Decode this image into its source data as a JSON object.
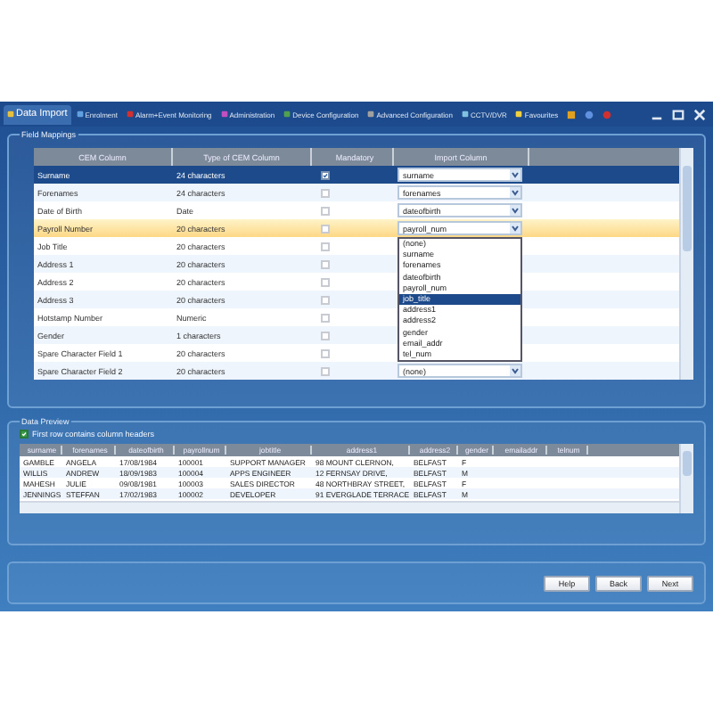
{
  "window": {
    "tabs": [
      {
        "label": "Data Import",
        "selected": true
      },
      {
        "label": "Enrolment",
        "selected": false
      },
      {
        "label": "Alarm+Event Monitoring",
        "selected": false
      },
      {
        "label": "Administration",
        "selected": false
      },
      {
        "label": "Device Configuration",
        "selected": false
      },
      {
        "label": "Advanced Configuration",
        "selected": false
      },
      {
        "label": "CCTV/DVR",
        "selected": false
      },
      {
        "label": "Favourites",
        "selected": false
      }
    ]
  },
  "field_mappings": {
    "title": "Field Mappings",
    "columns": [
      "CEM Column",
      "Type of CEM Column",
      "Mandatory",
      "Import Column"
    ],
    "rows": [
      {
        "cem_column": "Surname",
        "type": "24 characters",
        "mandatory": true,
        "import_column": "surname",
        "selected": true,
        "highlighted": false
      },
      {
        "cem_column": "Forenames",
        "type": "24 characters",
        "mandatory": false,
        "import_column": "forenames",
        "selected": false,
        "highlighted": false
      },
      {
        "cem_column": "Date of Birth",
        "type": "Date",
        "mandatory": false,
        "import_column": "dateofbirth",
        "selected": false,
        "highlighted": false
      },
      {
        "cem_column": "Payroll Number",
        "type": "20 characters",
        "mandatory": false,
        "import_column": "payroll_num",
        "selected": false,
        "highlighted": true
      },
      {
        "cem_column": "Job Title",
        "type": "20 characters",
        "mandatory": false,
        "selected": false,
        "highlighted": false
      },
      {
        "cem_column": "Address 1",
        "type": "20 characters",
        "mandatory": false,
        "selected": false,
        "highlighted": false
      },
      {
        "cem_column": "Address 2",
        "type": "20 characters",
        "mandatory": false,
        "selected": false,
        "highlighted": false
      },
      {
        "cem_column": "Address 3",
        "type": "20 characters",
        "mandatory": false,
        "selected": false,
        "highlighted": false
      },
      {
        "cem_column": "Hotstamp Number",
        "type": "Numeric",
        "mandatory": false,
        "selected": false,
        "highlighted": false
      },
      {
        "cem_column": "Gender",
        "type": "1 characters",
        "mandatory": false,
        "selected": false,
        "highlighted": false
      },
      {
        "cem_column": "Spare Character Field 1",
        "type": "20 characters",
        "mandatory": false,
        "selected": false,
        "highlighted": false
      },
      {
        "cem_column": "Spare Character Field 2",
        "type": "20 characters",
        "mandatory": false,
        "import_column": "(none)",
        "selected": false,
        "highlighted": false
      }
    ],
    "dropdown": {
      "options": [
        {
          "label": "(none)",
          "selected": false
        },
        {
          "label": "surname",
          "selected": false
        },
        {
          "label": "forenames",
          "selected": false
        },
        {
          "label": "dateofbirth",
          "selected": false
        },
        {
          "label": "payroll_num",
          "selected": false
        },
        {
          "label": "job_title",
          "selected": true
        },
        {
          "label": "address1",
          "selected": false
        },
        {
          "label": "address2",
          "selected": false
        },
        {
          "label": "gender",
          "selected": false
        },
        {
          "label": "email_addr",
          "selected": false
        },
        {
          "label": "tel_num",
          "selected": false
        }
      ]
    }
  },
  "data_preview": {
    "title": "Data Preview",
    "first_row_headers": {
      "label": "First row contains column headers",
      "checked": true
    },
    "columns": [
      "surname",
      "forenames",
      "dateofbirth",
      "payrollnum",
      "jobtitle",
      "address1",
      "address2",
      "gender",
      "emailaddr",
      "telnum"
    ],
    "rows": [
      [
        "GAMBLE",
        "ANGELA",
        "17/08/1984",
        "100001",
        "SUPPORT MANAGER",
        "98 MOUNT CLERNON,",
        "BELFAST",
        "F"
      ],
      [
        "WILLIS",
        "ANDREW",
        "18/09/1983",
        "100004",
        "APPS ENGINEER",
        "12 FERNSAY DRIVE,",
        "BELFAST",
        "M"
      ],
      [
        "MAHESH",
        "JULIE",
        "09/08/1981",
        "100003",
        "SALES DIRECTOR",
        "48 NORTHBRAY STREET,",
        "BELFAST",
        "F"
      ],
      [
        "JENNINGS",
        "STEFFAN",
        "17/02/1983",
        "100002",
        "DEVELOPER",
        "91 EVERGLADE TERRACE",
        "BELFAST",
        "M"
      ]
    ]
  },
  "buttons": [
    "Help",
    "Back",
    "Next"
  ]
}
